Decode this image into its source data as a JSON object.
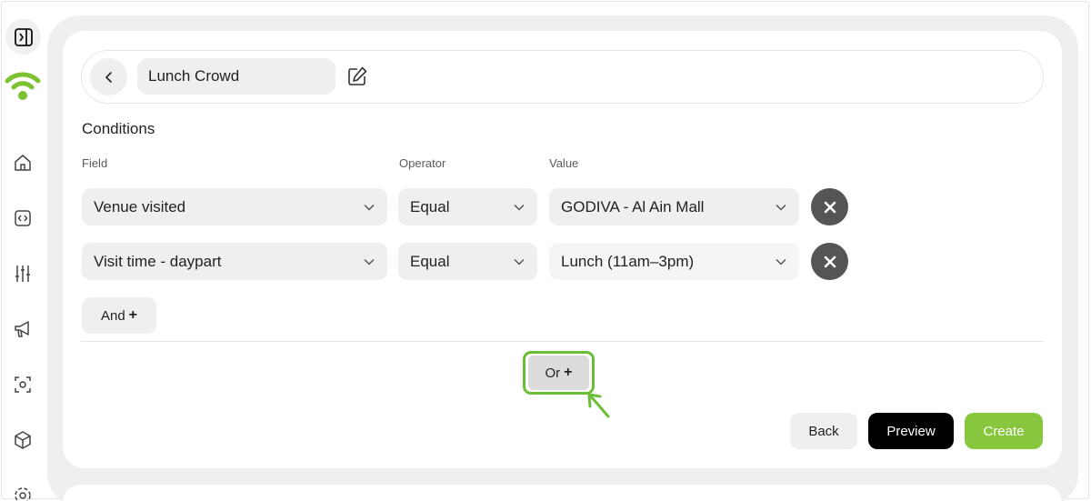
{
  "segment": {
    "name": "Lunch Crowd"
  },
  "conditions": {
    "title": "Conditions",
    "columns": {
      "field": "Field",
      "operator": "Operator",
      "value": "Value"
    },
    "rows": [
      {
        "field": "Venue visited",
        "operator": "Equal",
        "value": "GODIVA - Al Ain Mall"
      },
      {
        "field": "Visit time - daypart",
        "operator": "Equal",
        "value": "Lunch (11am–3pm)"
      }
    ],
    "and_label": "And",
    "or_label": "Or"
  },
  "actions": {
    "back": "Back",
    "preview": "Preview",
    "create": "Create"
  },
  "sidebar": {
    "icons": [
      "panel-toggle-icon",
      "home-icon",
      "code-icon",
      "sliders-icon",
      "megaphone-icon",
      "scan-icon",
      "box-icon",
      "settings-icon"
    ]
  },
  "colors": {
    "accent": "#86c73d",
    "highlight": "#6bbd35",
    "logo": "#7cc12f"
  }
}
